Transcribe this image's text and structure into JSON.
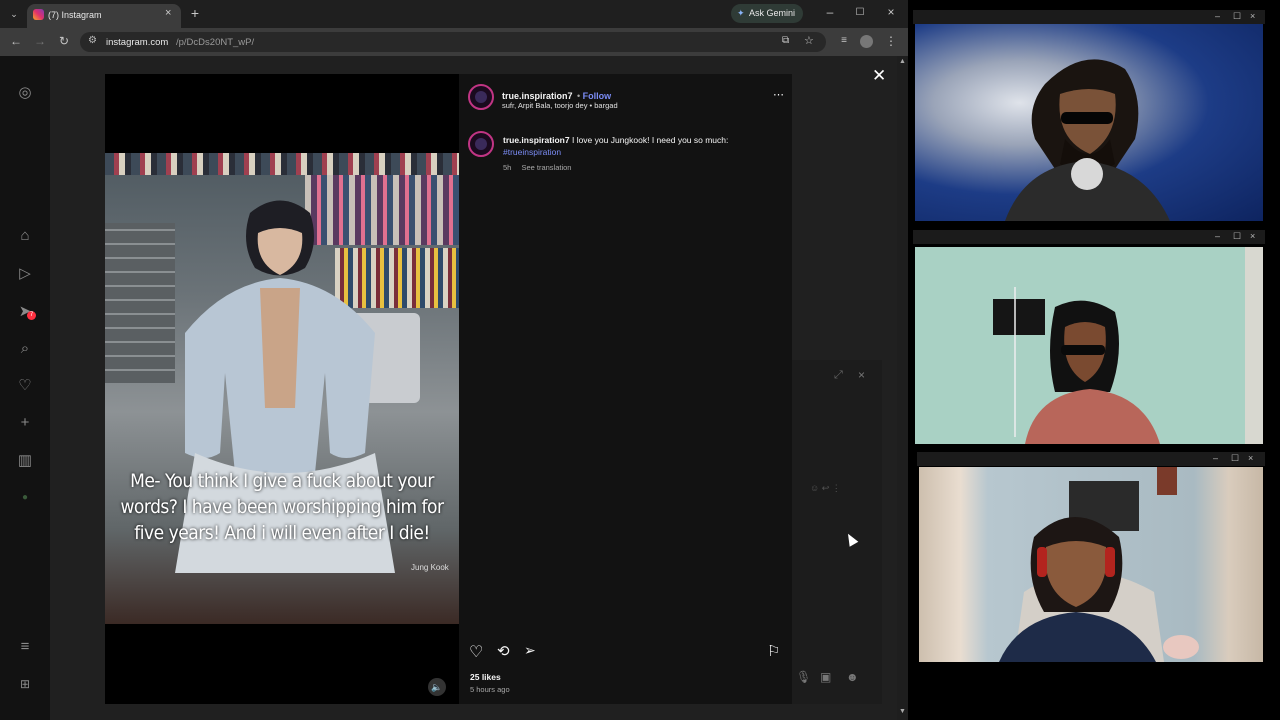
{
  "browser": {
    "tab_title": "(7) Instagram",
    "url_domain": "instagram.com",
    "url_path": "/p/DcDs20NT_wP/",
    "ask_gemini": "Ask Gemini"
  },
  "post": {
    "username": "true.inspiration7",
    "follow_label": "Follow",
    "collaborators": "sufr, Arpit Bala, toorjo dey • bargad",
    "caption_user": "true.inspiration7",
    "caption_text": "I love you Jungkook! I need you so much:",
    "hashtag": "#trueinspiration",
    "time_ago": "5h",
    "see_translation": "See translation",
    "likes": "25 likes",
    "posted": "5 hours ago"
  },
  "video": {
    "overlay_text": "Me- You think I give a fuck about your words? I have been worshipping him for five years! And i will even after I die!",
    "watermark": "Jung Kook"
  },
  "sidebar": {
    "notification_count": "7"
  },
  "colors": {
    "accent_blue": "#7b8cf5",
    "story_ring": "#c13584",
    "panel_bg": "#121212"
  }
}
